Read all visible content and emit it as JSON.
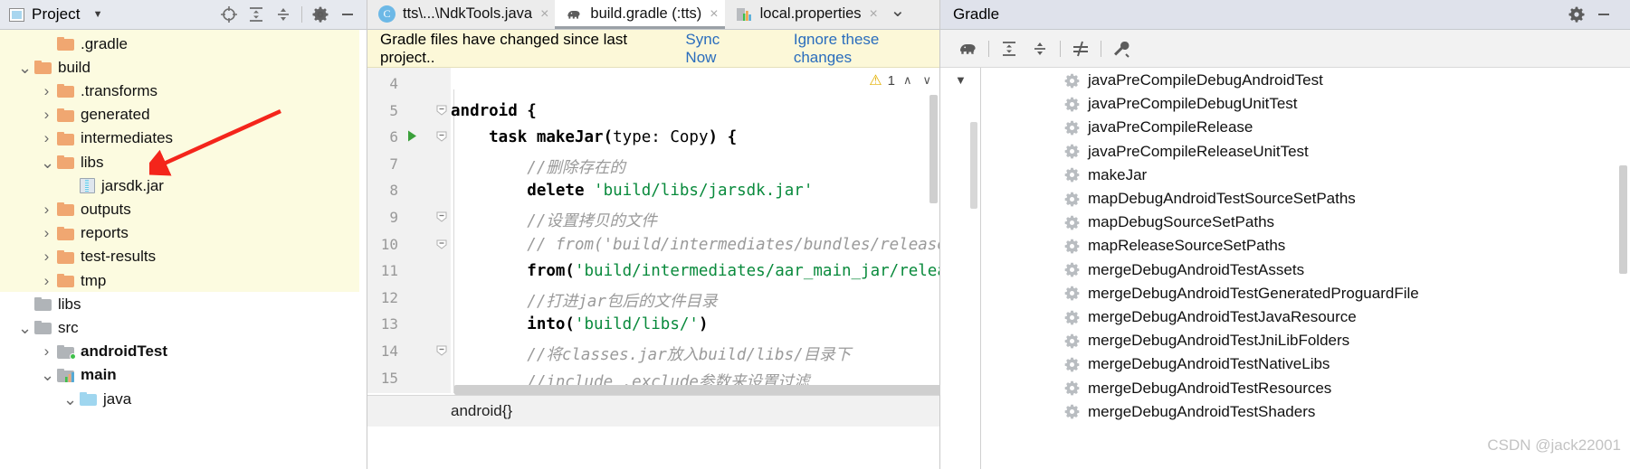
{
  "project": {
    "title": "Project",
    "icons": [
      "project-square-icon",
      "chevron-down-icon",
      "locate-icon",
      "expand-all-icon",
      "collapse-all-icon",
      "gear-icon",
      "minimize-icon"
    ],
    "tree": [
      {
        "label": ".gradle",
        "depth": 2,
        "arrow": "",
        "icon": "folder-orange",
        "bold": false,
        "hl": true
      },
      {
        "label": "build",
        "depth": 1,
        "arrow": "v",
        "icon": "folder-orange",
        "bold": false,
        "hl": true
      },
      {
        "label": ".transforms",
        "depth": 2,
        "arrow": ">",
        "icon": "folder-orange",
        "bold": false,
        "hl": true
      },
      {
        "label": "generated",
        "depth": 2,
        "arrow": ">",
        "icon": "folder-orange",
        "bold": false,
        "hl": true
      },
      {
        "label": "intermediates",
        "depth": 2,
        "arrow": ">",
        "icon": "folder-orange",
        "bold": false,
        "hl": true
      },
      {
        "label": "libs",
        "depth": 2,
        "arrow": "v",
        "icon": "folder-orange",
        "bold": false,
        "hl": true
      },
      {
        "label": "jarsdk.jar",
        "depth": 3,
        "arrow": "",
        "icon": "jar-file",
        "bold": false,
        "hl": true
      },
      {
        "label": "outputs",
        "depth": 2,
        "arrow": ">",
        "icon": "folder-orange",
        "bold": false,
        "hl": true
      },
      {
        "label": "reports",
        "depth": 2,
        "arrow": ">",
        "icon": "folder-orange",
        "bold": false,
        "hl": true
      },
      {
        "label": "test-results",
        "depth": 2,
        "arrow": ">",
        "icon": "folder-orange",
        "bold": false,
        "hl": true
      },
      {
        "label": "tmp",
        "depth": 2,
        "arrow": ">",
        "icon": "folder-orange",
        "bold": false,
        "hl": true
      },
      {
        "label": "libs",
        "depth": 1,
        "arrow": "",
        "icon": "folder-grey",
        "bold": false,
        "hl": false
      },
      {
        "label": "src",
        "depth": 1,
        "arrow": "v",
        "icon": "folder-grey",
        "bold": false,
        "hl": false
      },
      {
        "label": "androidTest",
        "depth": 2,
        "arrow": ">",
        "icon": "folder-grey-dot",
        "bold": true,
        "hl": false
      },
      {
        "label": "main",
        "depth": 2,
        "arrow": "v",
        "icon": "folder-grey-bars",
        "bold": true,
        "hl": false
      },
      {
        "label": "java",
        "depth": 3,
        "arrow": "v",
        "icon": "folder-blue",
        "bold": false,
        "hl": false
      }
    ]
  },
  "editor": {
    "tabs": [
      {
        "label": "tts\\...\\NdkTools.java",
        "icon": "java-class-icon",
        "active": false,
        "close": "×"
      },
      {
        "label": "build.gradle (:tts)",
        "icon": "gradle-elephant-icon",
        "active": true,
        "close": "×"
      },
      {
        "label": "local.properties",
        "icon": "properties-icon",
        "active": false,
        "close": "×"
      }
    ],
    "tab_overflow_icon": "chevron-down-icon",
    "notification": {
      "message": "Gradle files have changed since last project..",
      "sync_label": "Sync Now",
      "ignore_label": "Ignore these changes"
    },
    "inspection": {
      "warning_count": "1",
      "warning_icon": "warning-triangle-icon",
      "up": "∧",
      "down": "∨"
    },
    "line_numbers": [
      "4",
      "5",
      "6",
      "7",
      "8",
      "9",
      "10",
      "11",
      "12",
      "13",
      "14",
      "15"
    ],
    "code_lines": [
      {
        "n": "4",
        "segments": []
      },
      {
        "n": "5",
        "segments": [
          {
            "t": "android {",
            "c": "kw"
          }
        ]
      },
      {
        "n": "6",
        "segments": [
          {
            "t": "    task makeJar(",
            "c": "kw"
          },
          {
            "t": "type: ",
            "c": "nm"
          },
          {
            "t": "Copy",
            "c": "nm"
          },
          {
            "t": ") {",
            "c": "kw"
          }
        ]
      },
      {
        "n": "7",
        "segments": [
          {
            "t": "        //删除存在的",
            "c": "cmt"
          }
        ]
      },
      {
        "n": "8",
        "segments": [
          {
            "t": "        delete ",
            "c": "kw"
          },
          {
            "t": "'build/libs/jarsdk.jar'",
            "c": "str"
          }
        ]
      },
      {
        "n": "9",
        "segments": [
          {
            "t": "        //设置拷贝的文件",
            "c": "cmt"
          }
        ]
      },
      {
        "n": "10",
        "segments": [
          {
            "t": "        // from('build/intermediates/bundles/release",
            "c": "cmt"
          }
        ]
      },
      {
        "n": "11",
        "segments": [
          {
            "t": "        from(",
            "c": "kw"
          },
          {
            "t": "'build/intermediates/aar_main_jar/relea",
            "c": "str"
          }
        ]
      },
      {
        "n": "12",
        "segments": [
          {
            "t": "        //打进jar包后的文件目录",
            "c": "cmt"
          }
        ]
      },
      {
        "n": "13",
        "segments": [
          {
            "t": "        into(",
            "c": "kw"
          },
          {
            "t": "'build/libs/'",
            "c": "str"
          },
          {
            "t": ")",
            "c": "kw"
          }
        ]
      },
      {
        "n": "14",
        "segments": [
          {
            "t": "        //将classes.jar放入build/libs/目录下",
            "c": "cmt"
          }
        ]
      },
      {
        "n": "15",
        "segments": [
          {
            "t": "        //include ,exclude参数来设置过滤",
            "c": "cmt"
          }
        ]
      }
    ],
    "breadcrumb": "android{}",
    "run_gutter_icon": "run-triangle-icon"
  },
  "gradle": {
    "title": "Gradle",
    "header_icons": [
      "gear-icon",
      "minimize-icon"
    ],
    "toolbar_icons": [
      "elephant-sync-icon",
      "expand-all-icon",
      "collapse-all-icon",
      "toggle-offline-icon",
      "wrench-icon"
    ],
    "tasks": [
      "javaPreCompileDebugAndroidTest",
      "javaPreCompileDebugUnitTest",
      "javaPreCompileRelease",
      "javaPreCompileReleaseUnitTest",
      "makeJar",
      "mapDebugAndroidTestSourceSetPaths",
      "mapDebugSourceSetPaths",
      "mapReleaseSourceSetPaths",
      "mergeDebugAndroidTestAssets",
      "mergeDebugAndroidTestGeneratedProguardFile",
      "mergeDebugAndroidTestJavaResource",
      "mergeDebugAndroidTestJniLibFolders",
      "mergeDebugAndroidTestNativeLibs",
      "mergeDebugAndroidTestResources",
      "mergeDebugAndroidTestShaders"
    ],
    "task_icon": "gear-task-icon"
  },
  "watermark": "CSDN @jack22001",
  "colors": {
    "highlight_row": "#fcfbe0",
    "notification_bg": "#fcf8d8",
    "link": "#2a6dbd",
    "arrow_red": "#f4251b",
    "folder_orange": "#f0a771",
    "string_green": "#098a3c",
    "comment_grey": "#9a9a9a",
    "panel_header": "#e6e9ef",
    "gradle_header": "#dfe2eb"
  }
}
